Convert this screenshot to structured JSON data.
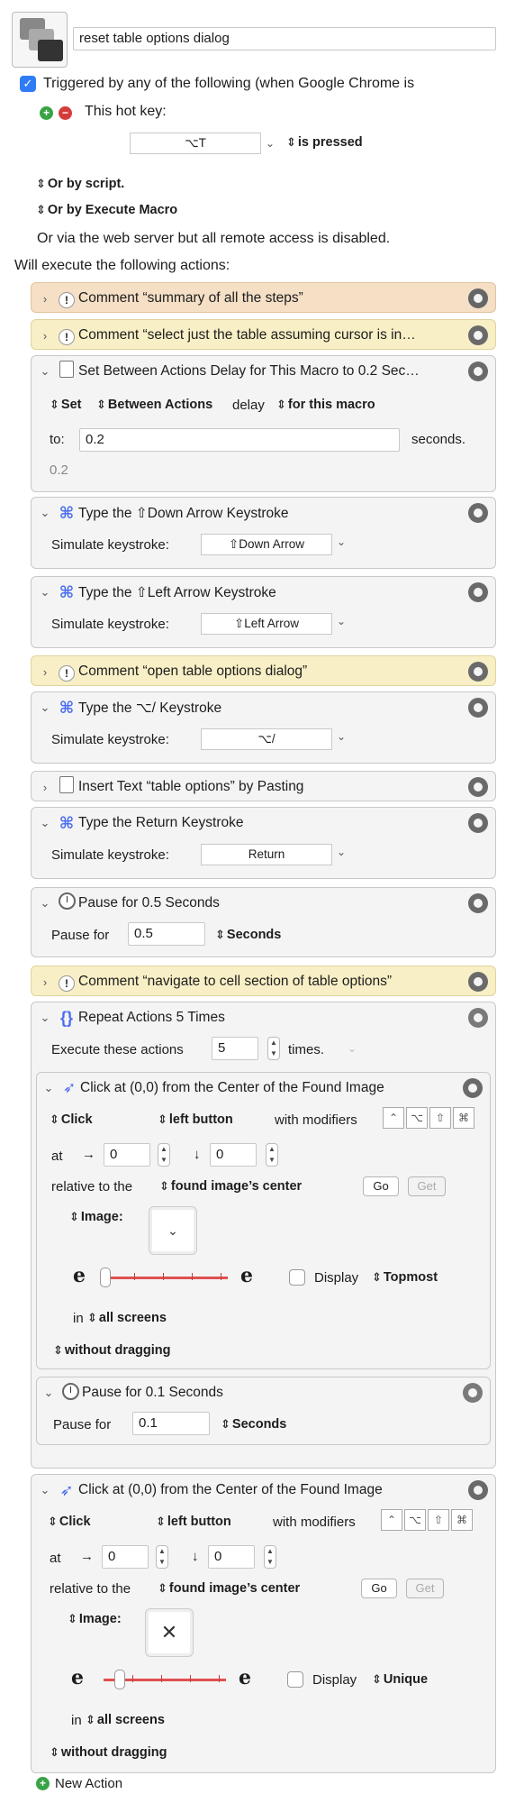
{
  "macro": {
    "name": "reset table options dialog",
    "trigger_label": "Triggered by any of the following (when Google Chrome is",
    "hotkey_label": "This hot key:",
    "hotkey_value": "⌥T",
    "hotkey_state": "is pressed",
    "or_by_script": "Or by script.",
    "or_by_execute": "Or by Execute Macro",
    "web_server_note": "Or via the web server but all remote access is disabled.",
    "will_execute": "Will execute the following actions:"
  },
  "actions": {
    "a1": {
      "title": "Comment “summary of all the steps”"
    },
    "a2": {
      "title": "Comment “select just the table assuming cursor is in…"
    },
    "a3": {
      "title": "Set Between Actions Delay for This Macro to 0.2 Sec…",
      "set": "Set",
      "between": "Between Actions",
      "delay": "delay",
      "for_macro": "for this macro",
      "to_label": "to:",
      "to_value": "0.2",
      "seconds": "seconds.",
      "result": "0.2"
    },
    "a4": {
      "title": "Type the ⇧Down Arrow Keystroke",
      "sim_label": "Simulate keystroke:",
      "key": "⇧Down Arrow"
    },
    "a5": {
      "title": "Type the ⇧Left Arrow Keystroke",
      "sim_label": "Simulate keystroke:",
      "key": "⇧Left Arrow"
    },
    "a6": {
      "title": "Comment “open table options dialog”"
    },
    "a7": {
      "title": "Type the ⌥/ Keystroke",
      "sim_label": "Simulate keystroke:",
      "key": "⌥/"
    },
    "a8": {
      "title": "Insert Text “table options” by Pasting"
    },
    "a9": {
      "title": "Type the Return Keystroke",
      "sim_label": "Simulate keystroke:",
      "key": "Return"
    },
    "a10": {
      "title": "Pause for 0.5 Seconds",
      "pause_label": "Pause for",
      "value": "0.5",
      "unit": "Seconds"
    },
    "a11": {
      "title": "Comment “navigate to cell section of table options”"
    },
    "a12": {
      "title": "Repeat Actions 5 Times",
      "exec_label": "Execute these actions",
      "count": "5",
      "times": "times.",
      "inner_click": {
        "title": "Click at (0,0) from the Center of the Found Image",
        "click": "Click",
        "button": "left button",
        "with_mod": "with modifiers",
        "at": "at",
        "x": "0",
        "y": "0",
        "relative": "relative to the",
        "relative_value": "found image’s center",
        "go": "Go",
        "get": "Get",
        "image_label": "Image:",
        "image_glyph": "⌄",
        "display": "Display",
        "display_mode": "Topmost",
        "in_label": "in",
        "screens": "all screens",
        "dragging": "without dragging"
      },
      "inner_pause": {
        "title": "Pause for 0.1 Seconds",
        "pause_label": "Pause for",
        "value": "0.1",
        "unit": "Seconds"
      }
    },
    "a13": {
      "title": "Click at (0,0) from the Center of the Found Image",
      "click": "Click",
      "button": "left button",
      "with_mod": "with modifiers",
      "at": "at",
      "x": "0",
      "y": "0",
      "relative": "relative to the",
      "relative_value": "found image’s center",
      "go": "Go",
      "get": "Get",
      "image_label": "Image:",
      "image_glyph": "✕",
      "display": "Display",
      "display_mode": "Unique",
      "in_label": "in",
      "screens": "all screens",
      "dragging": "without dragging"
    }
  },
  "new_action": "New Action",
  "modifiers": [
    "⌃",
    "⌥",
    "⇧",
    "⌘"
  ],
  "colors": {
    "accent": "#2f7cf6",
    "comment_orange": "#f5dfc5",
    "comment_yellow": "#f8efc6",
    "slider": "#e05050"
  }
}
